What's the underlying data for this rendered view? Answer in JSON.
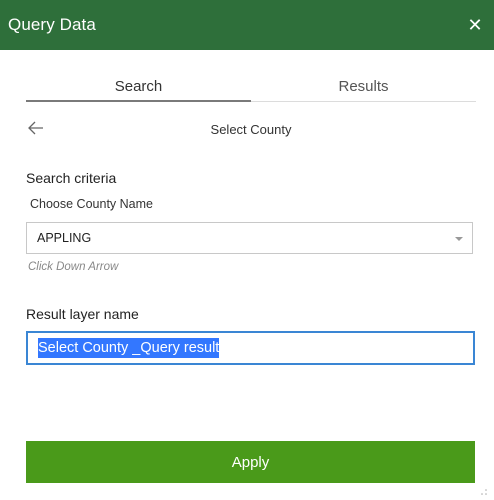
{
  "window": {
    "title": "Query Data",
    "close_icon": "close-icon",
    "accent_color": "#2e6f3a"
  },
  "tabs": [
    {
      "label": "Search",
      "active": true
    },
    {
      "label": "Results",
      "active": false
    }
  ],
  "subheader": {
    "back_icon": "arrow-left-icon",
    "label": "Select County"
  },
  "search": {
    "section_title": "Search criteria",
    "field_label": "Choose County Name",
    "selected_value": "APPLING",
    "hint": "Click Down Arrow"
  },
  "result_layer": {
    "section_title": "Result layer name",
    "value": "Select County _Query result",
    "focus_color": "#3a86d4"
  },
  "actions": {
    "apply_label": "Apply",
    "apply_color": "#4a9a1a"
  }
}
